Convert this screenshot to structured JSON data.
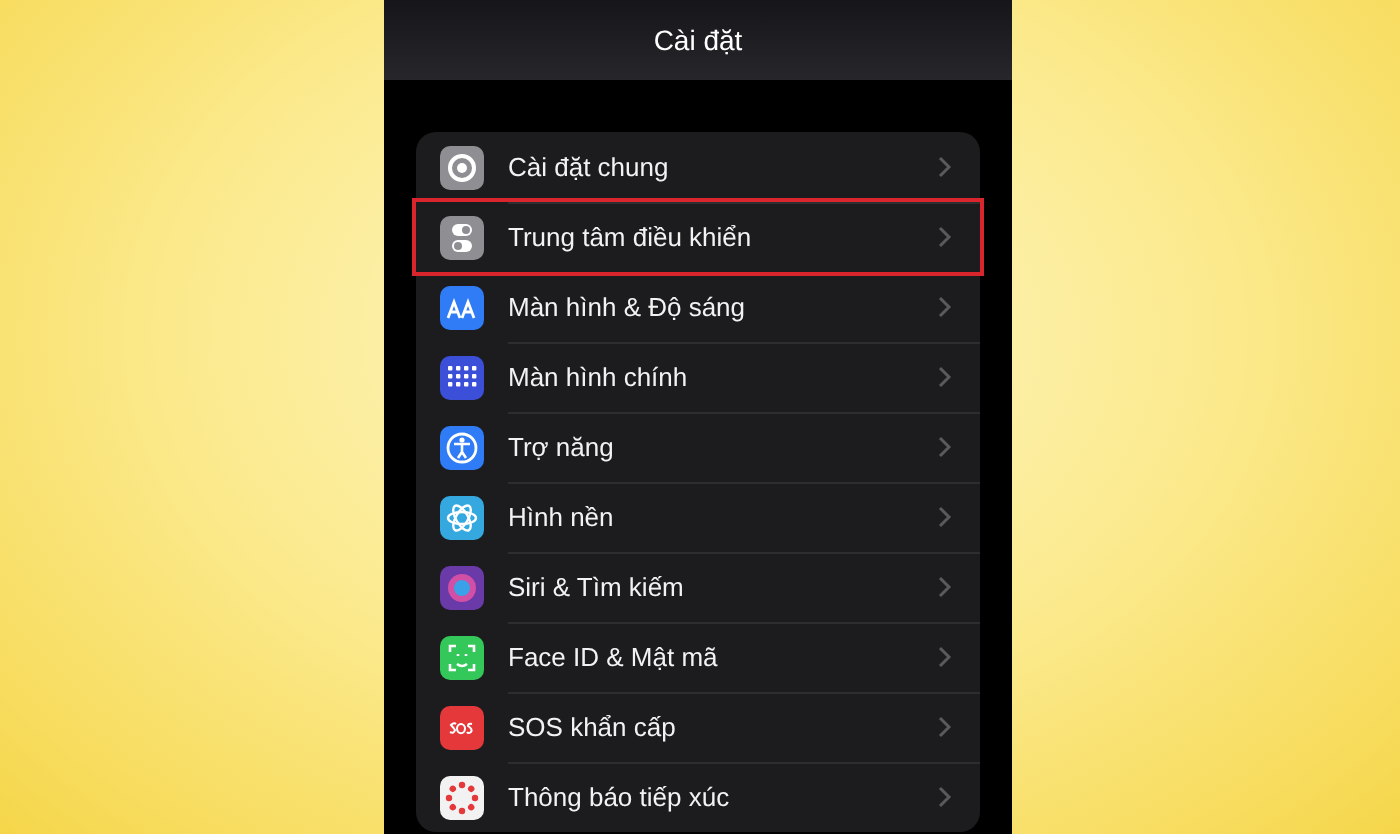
{
  "screen": {
    "title": "Cài đặt"
  },
  "settings": [
    {
      "label": "Cài đặt chung",
      "color": "#8e8e93",
      "highlighted": false
    },
    {
      "label": "Trung tâm điều khiển",
      "color": "#8e8e93",
      "highlighted": true
    },
    {
      "label": "Màn hình & Độ sáng",
      "color": "#2f7cf6",
      "highlighted": false
    },
    {
      "label": "Màn hình chính",
      "color": "#3b4fd8",
      "highlighted": false
    },
    {
      "label": "Trợ năng",
      "color": "#2f7cf6",
      "highlighted": false
    },
    {
      "label": "Hình nền",
      "color": "#36a8e0",
      "highlighted": false
    },
    {
      "label": "Siri & Tìm kiếm",
      "color": "#6a3aa8",
      "highlighted": false
    },
    {
      "label": "Face ID & Mật mã",
      "color": "#34c759",
      "highlighted": false
    },
    {
      "label": "SOS khẩn cấp",
      "color": "#e5383b",
      "highlighted": false
    },
    {
      "label": "Thông báo tiếp xúc",
      "color": "#f2f2f2",
      "highlighted": false
    }
  ]
}
